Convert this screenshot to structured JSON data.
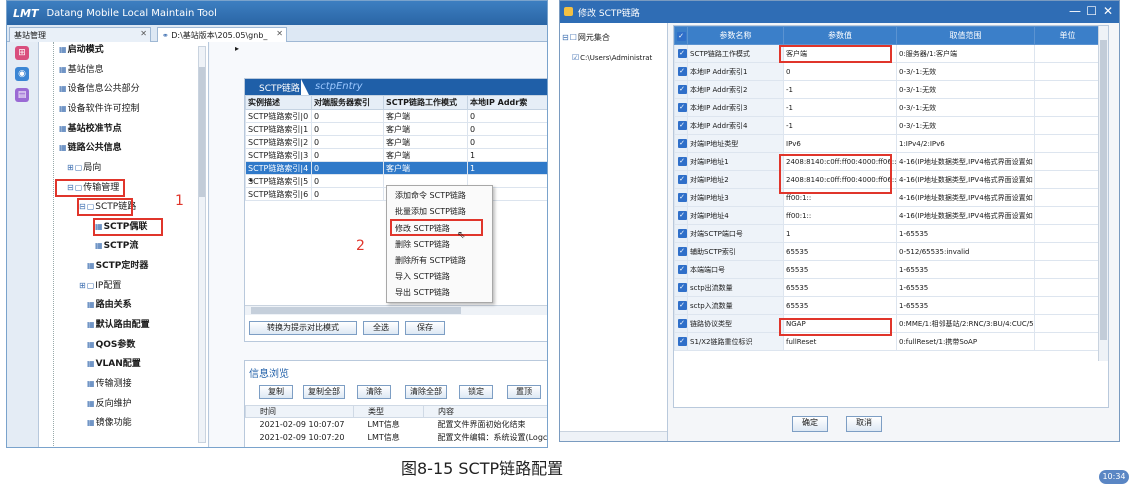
{
  "left_window": {
    "app_logo": "LMT",
    "title": "Datang Mobile Local Maintain Tool",
    "tabs": [
      {
        "label": "基站管理"
      },
      {
        "label": "D:\\基站版本\\205.05\\gnb_"
      }
    ],
    "tree": {
      "items": [
        "启动模式",
        "基站信息",
        "设备信息公共部分",
        "设备软件许可控制",
        "基站校准节点",
        "链路公共信息",
        "局向",
        "传输管理",
        "SCTP链路",
        "SCTP偶联",
        "SCTP流",
        "SCTP定时器",
        "IP配置",
        "路由关系",
        "默认路由配置",
        "QOS参数",
        "VLAN配置",
        "传输测接",
        "反向维护",
        "镜像功能"
      ]
    },
    "sctp_panel": {
      "tab": "SCTP链路",
      "entry": "sctpEntry",
      "columns": [
        "实例描述",
        "对端服务器索引",
        "SCTP链路工作模式",
        "本地IP Addr索"
      ],
      "rows": [
        [
          "SCTP链路索引|0",
          "0",
          "客户端",
          "0"
        ],
        [
          "SCTP链路索引|1",
          "0",
          "客户端",
          "0"
        ],
        [
          "SCTP链路索引|2",
          "0",
          "客户端",
          "0"
        ],
        [
          "SCTP链路索引|3",
          "0",
          "客户端",
          "1"
        ],
        [
          "SCTP链路索引|4",
          "0",
          "客户端",
          "1"
        ],
        [
          "SCTP链路索引|5",
          "0",
          "",
          ""
        ],
        [
          "SCTP链路索引|6",
          "0",
          "",
          ""
        ]
      ],
      "buttons": [
        "转换为提示对比模式",
        "全选",
        "保存"
      ]
    },
    "context_menu": [
      "添加命令 SCTP链路",
      "批量添加 SCTP链路",
      "修改 SCTP链路",
      "删除 SCTP链路",
      "删除所有 SCTP链路",
      "导入 SCTP链路",
      "导出 SCTP链路"
    ],
    "info": {
      "title": "信息浏览",
      "buttons": [
        "复制",
        "复制全部",
        "清除",
        "清除全部",
        "锁定",
        "置顶"
      ],
      "columns": [
        "时间",
        "类型",
        "内容"
      ],
      "rows": [
        [
          "2021-02-09 10:07:07",
          "LMT信息",
          "配置文件界面初始化结束"
        ],
        [
          "2021-02-09 10:07:20",
          "LMT信息",
          "配置文件编辑：系统设置(Logcd"
        ]
      ]
    },
    "annotations": {
      "n1": "1",
      "n2": "2"
    }
  },
  "right_window": {
    "title": "修改 SCTP链路",
    "tree_root": "网元集合",
    "tree_child": "C:\\Users\\Administrat",
    "columns": [
      "参数名称",
      "参数值",
      "取值范围",
      "单位"
    ],
    "rows": [
      [
        "SCTP链路工作模式",
        "客户端",
        "0:服务器/1:客户端"
      ],
      [
        "本地IP Addr索引1",
        "0",
        "0-3/-1:无效"
      ],
      [
        "本地IP Addr索引2",
        "-1",
        "0-3/-1:无效"
      ],
      [
        "本地IP Addr索引3",
        "-1",
        "0-3/-1:无效"
      ],
      [
        "本地IP Addr索引4",
        "-1",
        "0-3/-1:无效"
      ],
      [
        "对端IP地址类型",
        "IPv6",
        "1:IPv4/2:IPv6"
      ],
      [
        "对端IP地址1",
        "2408:8140:c0ff:ff00:4000:ff06::1",
        "4-16(IP地址数据类型,IPV4格式界面设置如"
      ],
      [
        "对端IP地址2",
        "2408:8140:c0ff:ff00:4000:ff06::2",
        "4-16(IP地址数据类型,IPV4格式界面设置如"
      ],
      [
        "对端IP地址3",
        "ff00:1::",
        "4-16(IP地址数据类型,IPV4格式界面设置如"
      ],
      [
        "对端IP地址4",
        "ff00:1::",
        "4-16(IP地址数据类型,IPV4格式界面设置如"
      ],
      [
        "对端SCTP端口号",
        "1",
        "1-65535"
      ],
      [
        "辅助SCTP索引",
        "65535",
        "0-512/65535:invalid"
      ],
      [
        "本端端口号",
        "65535",
        "1-65535"
      ],
      [
        "sctp出流数量",
        "65535",
        "1-65535"
      ],
      [
        "sctp入流数量",
        "65535",
        "1-65535"
      ],
      [
        "链路协议类型",
        "NGAP",
        "0:MME/1:相邻基站/2:RNC/3:BU/4:CUC/5:Cl"
      ],
      [
        "S1/X2链路重位标识",
        "fullReset",
        "0:fullReset/1:携带SoAP"
      ]
    ],
    "buttons": {
      "ok": "确定",
      "cancel": "取消"
    }
  },
  "caption": "图8-15   SCTP链路配置",
  "clock": "10:34",
  "colors": {
    "accent": "#2f6db5",
    "highlight": "#e0352b",
    "selection": "#2f79c9"
  }
}
